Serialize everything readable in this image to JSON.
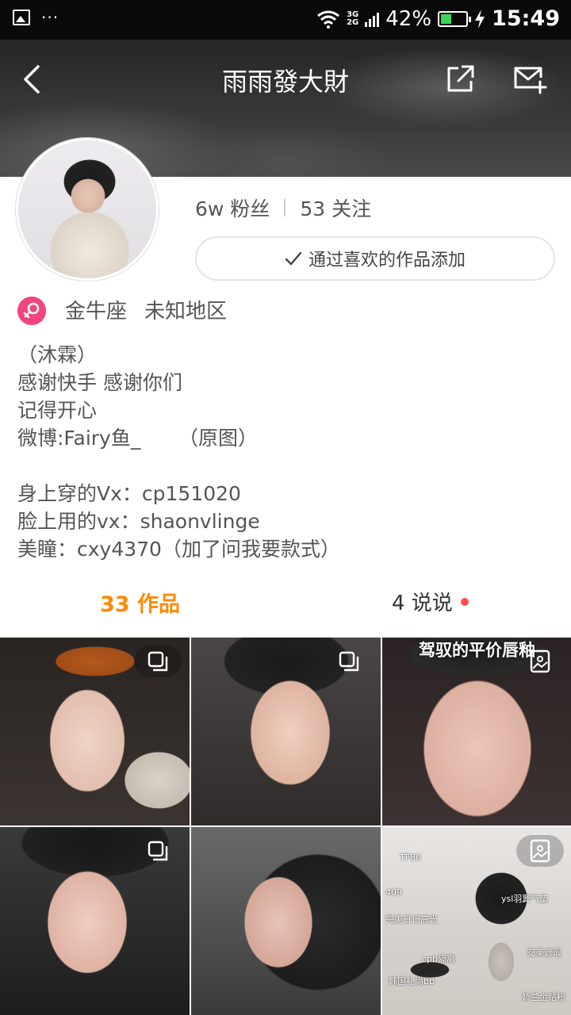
{
  "status_bar": {
    "net_top": "3G",
    "net_bottom": "2G",
    "battery_pct": "42%",
    "battery_level": 0.42,
    "time": "15:49",
    "dots": "···"
  },
  "header": {
    "title": "雨雨發大財"
  },
  "stats": {
    "fans": "6w 粉丝",
    "following": "53 关注"
  },
  "follow_hint": {
    "label": "通过喜欢的作品添加"
  },
  "profile": {
    "zodiac": "金牛座",
    "region": "未知地区",
    "bio": [
      "（沐霖）",
      "感谢快手 感谢你们",
      "记得开心",
      "微博:Fairy鱼_      （原图）",
      "",
      "身上穿的Vx：cp151020",
      "脸上用的vx：shaonvlinge",
      "美瞳：cxy4370（加了问我要款式）"
    ]
  },
  "tabs": {
    "works": "33 作品",
    "says": "4 说说"
  },
  "grid": {
    "tile3_overlay": "驾驭的平价唇釉",
    "tile6_labels": [
      "TF80",
      "ysl羽翼气垫",
      "完美日记高光",
      "cpb隔离",
      "安美遮瑕",
      "韩国礼尚bb",
      "娇兰金钻粉",
      "409"
    ]
  },
  "colors": {
    "accent": "#ff8a00",
    "gender": "#f0457d",
    "dot": "#ff4d4d",
    "battery": "#3dd65a"
  },
  "icons": [
    "image-icon",
    "wifi-icon",
    "signal-icon",
    "battery-icon",
    "charging-icon",
    "back-icon",
    "share-icon",
    "message-icon",
    "check-icon",
    "female-icon",
    "multi-photo-icon",
    "photo-icon"
  ]
}
